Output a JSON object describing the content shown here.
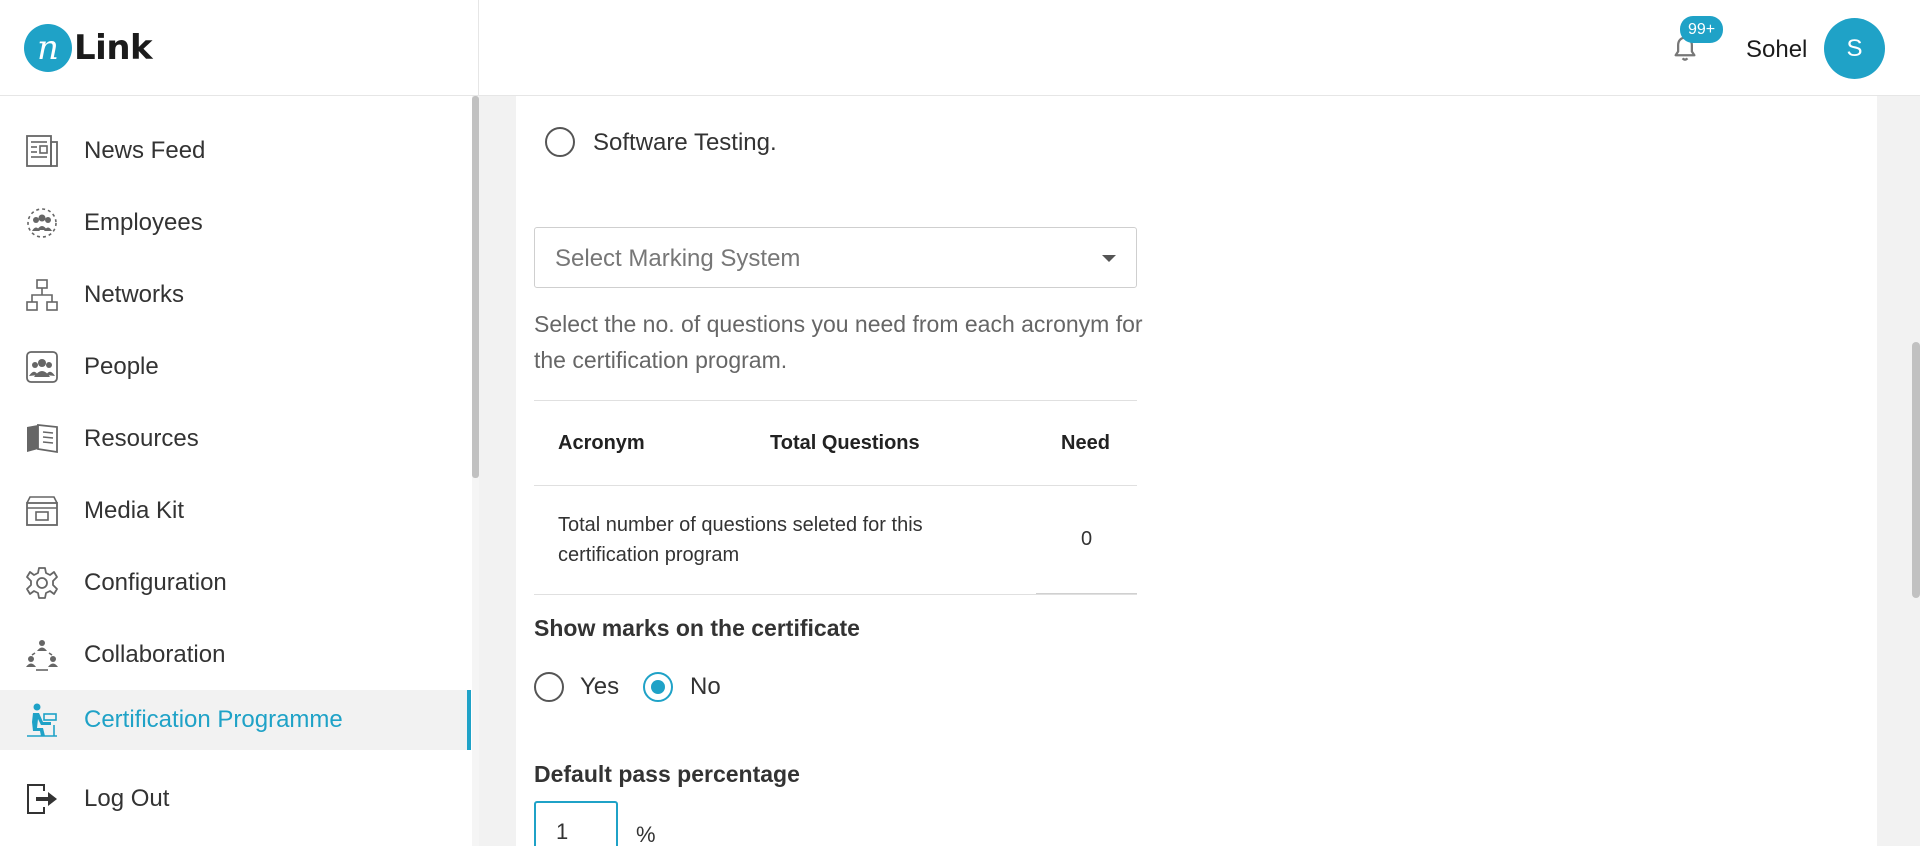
{
  "app": {
    "logo_mark": "n",
    "logo_text": "Link",
    "notifications_badge": "99+",
    "user_name": "Sohel",
    "user_initial": "S",
    "accent_color": "#1fa2c7"
  },
  "sidebar": {
    "items": [
      {
        "label": "News Feed",
        "icon": "newspaper-icon",
        "active": false
      },
      {
        "label": "Employees",
        "icon": "employees-icon",
        "active": false
      },
      {
        "label": "Networks",
        "icon": "network-icon",
        "active": false
      },
      {
        "label": "People",
        "icon": "people-icon",
        "active": false
      },
      {
        "label": "Resources",
        "icon": "book-icon",
        "active": false
      },
      {
        "label": "Media Kit",
        "icon": "media-kit-icon",
        "active": false
      },
      {
        "label": "Configuration",
        "icon": "gear-icon",
        "active": false
      },
      {
        "label": "Collaboration",
        "icon": "collaboration-icon",
        "active": false
      },
      {
        "label": "Certification Programme",
        "icon": "certification-icon",
        "active": true
      },
      {
        "label": "Log Out",
        "icon": "logout-icon",
        "active": false
      }
    ]
  },
  "form": {
    "course_option_label": "Software Testing.",
    "marking_select_placeholder": "Select Marking System",
    "help_text": "Select the no. of questions you need from each acronym for the certification program.",
    "table": {
      "headers": [
        "Acronym",
        "Total Questions",
        "Need"
      ],
      "total_row_label": "Total number of questions seleted for this certification program",
      "total_row_value": "0"
    },
    "show_marks": {
      "title": "Show marks on the certificate",
      "options": [
        {
          "label": "Yes",
          "checked": false
        },
        {
          "label": "No",
          "checked": true
        }
      ]
    },
    "pass_percentage": {
      "title": "Default pass percentage",
      "value": "1",
      "unit": "%"
    }
  }
}
